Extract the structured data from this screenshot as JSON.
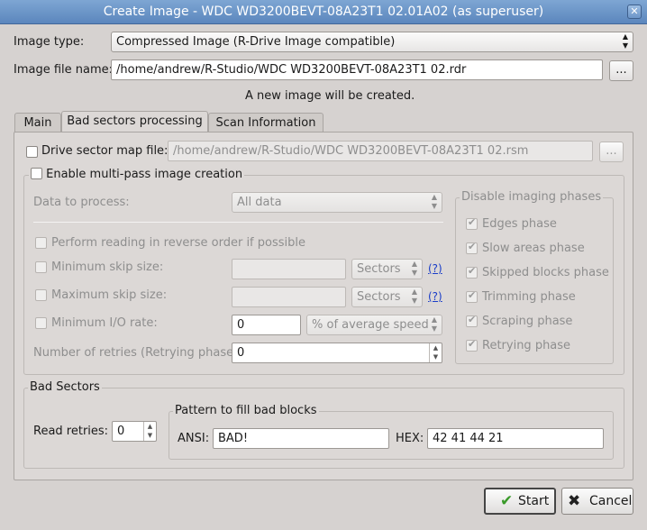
{
  "window": {
    "title": "Create Image - WDC WD3200BEVT-08A23T1 02.01A02 (as superuser)"
  },
  "image_type": {
    "label": "Image type:",
    "value": "Compressed Image (R-Drive Image compatible)"
  },
  "image_file": {
    "label": "Image file name:",
    "value": "/home/andrew/R-Studio/WDC WD3200BEVT-08A23T1 02.rdr",
    "browse_label": "..."
  },
  "status_text": "A new image will be created.",
  "tabs": [
    {
      "label": "Main",
      "active": false
    },
    {
      "label": "Bad sectors processing",
      "active": true
    },
    {
      "label": "Scan Information",
      "active": false
    }
  ],
  "drive_map": {
    "label": "Drive sector map file:",
    "value": "/home/andrew/R-Studio/WDC WD3200BEVT-08A23T1 02.rsm",
    "browse_label": "..."
  },
  "multipass": {
    "label": "Enable multi-pass image creation",
    "data_to_process_label": "Data to process:",
    "data_to_process_value": "All data",
    "reverse_label": "Perform reading in reverse order if possible",
    "min_skip_label": "Minimum skip size:",
    "min_skip_unit": "Sectors",
    "max_skip_label": "Maximum skip size:",
    "max_skip_unit": "Sectors",
    "min_io_label": "Minimum I/O rate:",
    "min_io_value": "0",
    "min_io_unit": "% of average speed",
    "retries_label": "Number of retries (Retrying phase):",
    "retries_value": "0",
    "help_label": "(?)"
  },
  "phases": {
    "title": "Disable imaging phases",
    "items": [
      {
        "label": "Edges phase",
        "checked": true
      },
      {
        "label": "Slow areas phase",
        "checked": true
      },
      {
        "label": "Skipped blocks phase",
        "checked": true
      },
      {
        "label": "Trimming phase",
        "checked": true
      },
      {
        "label": "Scraping phase",
        "checked": true
      },
      {
        "label": "Retrying phase",
        "checked": true
      }
    ]
  },
  "bad_sectors": {
    "title": "Bad Sectors",
    "read_retries_label": "Read retries:",
    "read_retries_value": "0",
    "pattern_title": "Pattern to fill bad blocks",
    "ansi_label": "ANSI:",
    "ansi_value": "BAD!",
    "hex_label": "HEX:",
    "hex_value": "42 41 44 21"
  },
  "buttons": {
    "start": "Start",
    "cancel": "Cancel"
  }
}
